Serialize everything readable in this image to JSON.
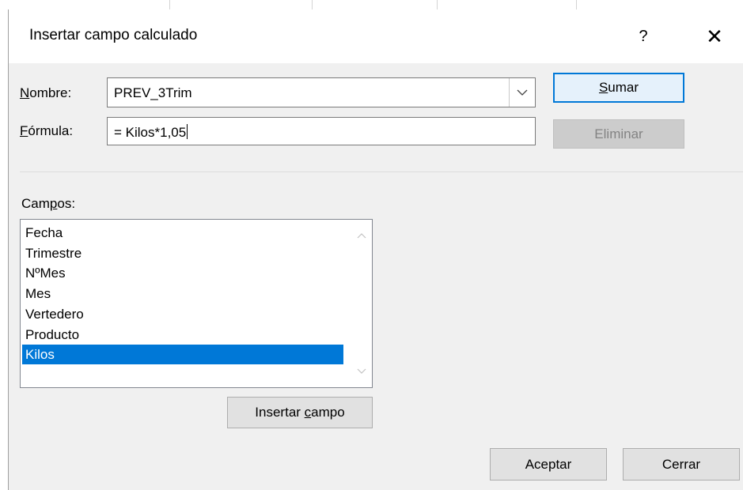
{
  "dialog": {
    "title": "Insertar campo calculado",
    "help_glyph": "?",
    "close_glyph": "✕"
  },
  "form": {
    "name_label_accel": "N",
    "name_label_rest": "ombre:",
    "name_value": "PREV_3Trim",
    "formula_label_accel": "F",
    "formula_label_rest": "órmula:",
    "formula_value": "= Kilos*1,05"
  },
  "buttons": {
    "sumar_accel": "S",
    "sumar_rest": "umar",
    "eliminar": "Eliminar",
    "insertar_pre": "Insertar ",
    "insertar_accel": "c",
    "insertar_post": "ampo",
    "aceptar": "Aceptar",
    "cerrar": "Cerrar"
  },
  "fields": {
    "label_pre": "Cam",
    "label_accel": "p",
    "label_post": "os:",
    "items": [
      "Fecha",
      "Trimestre",
      "NºMes",
      "Mes",
      "Vertedero",
      "Producto",
      "Kilos"
    ],
    "selected": "Kilos"
  },
  "colors": {
    "accent": "#0078d7",
    "dialog_bg": "#f0f0f0"
  }
}
